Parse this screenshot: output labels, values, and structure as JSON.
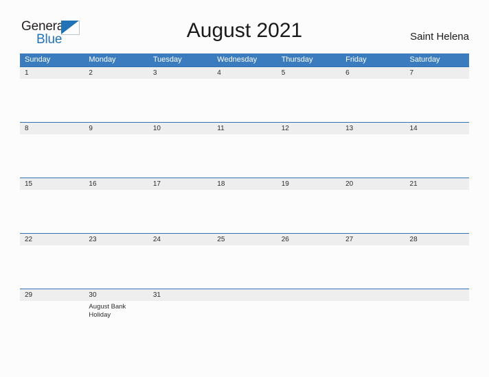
{
  "brand": {
    "logo_word_1": "General",
    "logo_word_2": "Blue",
    "logo_triangle_icon": "triangle-icon",
    "accent_color": "#2272b6"
  },
  "header": {
    "title": "August 2021",
    "locale": "Saint Helena"
  },
  "colors": {
    "header_blue": "#3a7cbd",
    "row_divider_blue": "#2f72b4",
    "date_band_gray": "#eeeeee",
    "page_background": "#fcfcfd",
    "text": "#1a1a1a"
  },
  "calendar": {
    "month": "August",
    "year": "2021",
    "weekday_headers": [
      "Sunday",
      "Monday",
      "Tuesday",
      "Wednesday",
      "Thursday",
      "Friday",
      "Saturday"
    ],
    "weeks": [
      {
        "days": [
          {
            "num": "1",
            "event": ""
          },
          {
            "num": "2",
            "event": ""
          },
          {
            "num": "3",
            "event": ""
          },
          {
            "num": "4",
            "event": ""
          },
          {
            "num": "5",
            "event": ""
          },
          {
            "num": "6",
            "event": ""
          },
          {
            "num": "7",
            "event": ""
          }
        ]
      },
      {
        "days": [
          {
            "num": "8",
            "event": ""
          },
          {
            "num": "9",
            "event": ""
          },
          {
            "num": "10",
            "event": ""
          },
          {
            "num": "11",
            "event": ""
          },
          {
            "num": "12",
            "event": ""
          },
          {
            "num": "13",
            "event": ""
          },
          {
            "num": "14",
            "event": ""
          }
        ]
      },
      {
        "days": [
          {
            "num": "15",
            "event": ""
          },
          {
            "num": "16",
            "event": ""
          },
          {
            "num": "17",
            "event": ""
          },
          {
            "num": "18",
            "event": ""
          },
          {
            "num": "19",
            "event": ""
          },
          {
            "num": "20",
            "event": ""
          },
          {
            "num": "21",
            "event": ""
          }
        ]
      },
      {
        "days": [
          {
            "num": "22",
            "event": ""
          },
          {
            "num": "23",
            "event": ""
          },
          {
            "num": "24",
            "event": ""
          },
          {
            "num": "25",
            "event": ""
          },
          {
            "num": "26",
            "event": ""
          },
          {
            "num": "27",
            "event": ""
          },
          {
            "num": "28",
            "event": ""
          }
        ]
      },
      {
        "days": [
          {
            "num": "29",
            "event": ""
          },
          {
            "num": "30",
            "event": "August Bank Holiday"
          },
          {
            "num": "31",
            "event": ""
          },
          {
            "num": "",
            "event": ""
          },
          {
            "num": "",
            "event": ""
          },
          {
            "num": "",
            "event": ""
          },
          {
            "num": "",
            "event": ""
          }
        ]
      }
    ]
  }
}
